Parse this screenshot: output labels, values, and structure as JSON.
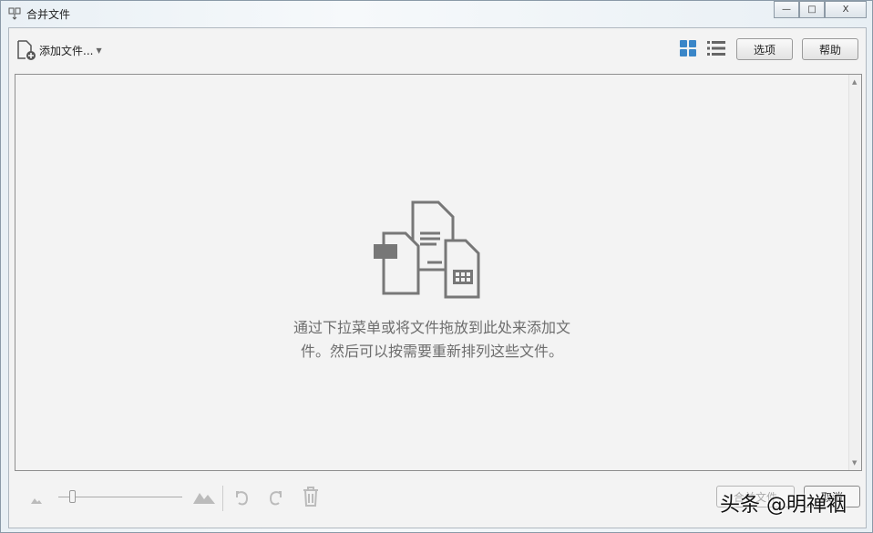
{
  "window": {
    "title": "合并文件",
    "minimize": "—",
    "maximize": "□",
    "close": "X"
  },
  "toolbar": {
    "add_files": "添加文件...",
    "options": "选项",
    "help": "帮助"
  },
  "dropzone": {
    "message_line1": "通过下拉菜单或将文件拖放到此处来添加文",
    "message_line2": "件。然后可以按需要重新排列这些文件。"
  },
  "bottom": {
    "combine": "合并文件",
    "cancel": "取消"
  },
  "watermark": "头条 @明禅裀",
  "colors": {
    "accent": "#3a86c8"
  }
}
